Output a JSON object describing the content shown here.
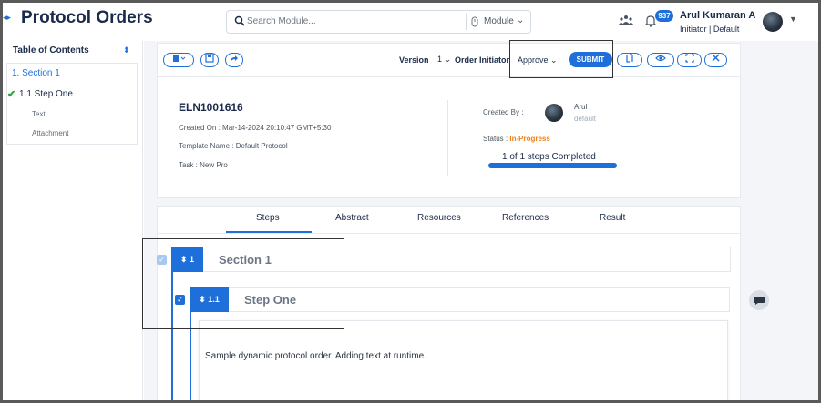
{
  "header": {
    "app_title": "Protocol Orders",
    "search_placeholder": "Search Module...",
    "module_label": "Module",
    "notification_count": "937",
    "user_name": "Arul Kumaran A",
    "user_role": "Initiator | Default"
  },
  "sidebar": {
    "title": "Table of Contents",
    "items": [
      {
        "label": "1.  Section 1"
      },
      {
        "label": "1.1    Step One"
      },
      {
        "label": "Text"
      },
      {
        "label": "Attachment"
      }
    ]
  },
  "toolbar": {
    "version_label": "Version",
    "version_value": "1",
    "order_initiator_label": "Order Initiator",
    "approve_value": "Approve",
    "submit_label": "SUBMIT"
  },
  "order": {
    "id": "ELN1001616",
    "created_on": "Created On : Mar-14-2024 20:10:47 GMT+5:30",
    "template_name": "Template Name : Default Protocol",
    "task": "Task : New Pro",
    "created_by_label": "Created By :",
    "creator_name": "Arul",
    "creator_sub": "default",
    "status_label": "Status :",
    "status_value": "In-Progress",
    "steps_completed": "1 of 1 steps Completed",
    "progress_fraction": 1.0
  },
  "tabs": [
    {
      "label": "Steps"
    },
    {
      "label": "Abstract"
    },
    {
      "label": "Resources"
    },
    {
      "label": "References"
    },
    {
      "label": "Result"
    }
  ],
  "protocol": {
    "section_number": "1",
    "section_title": "Section 1",
    "step_number": "1.1",
    "step_title": "Step One",
    "step_content": "Sample dynamic protocol order. Adding text at runtime."
  },
  "colors": {
    "accent": "#1e6fd9",
    "status_in_progress": "#f07f1a",
    "complete_check": "#2aa33a"
  }
}
